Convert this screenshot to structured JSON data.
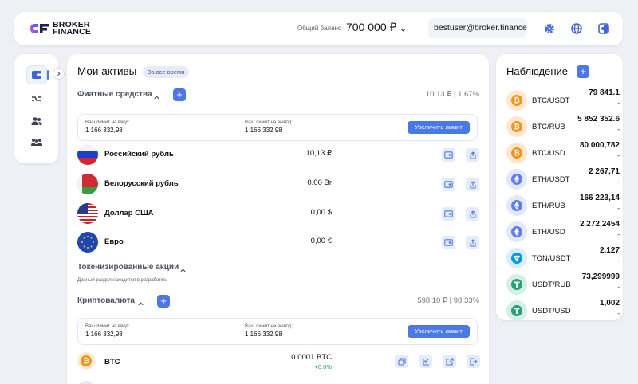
{
  "header": {
    "logo_line1": "BROKER",
    "logo_line2": "FINANCE",
    "balance_label": "Общий баланс",
    "balance_value": "700 000 ₽",
    "email": "bestuser@broker.finance",
    "icons": [
      "gear-icon",
      "globe-icon",
      "half-moon-icon"
    ]
  },
  "sidebar": {
    "items": [
      "wallet-icon",
      "exchange-icon",
      "users-icon",
      "handshake-icon"
    ]
  },
  "main": {
    "title": "Мои активы",
    "period_pill": "За все время",
    "fiat": {
      "title": "Фиатные средства",
      "summary": "10.13 ₽ | 1.67%",
      "limits": {
        "deposit_label": "Ваш лимит на ввод:",
        "deposit_value": "1 166 332,98",
        "withdraw_label": "Ваш лимит на вывод:",
        "withdraw_value": "1 166 332,98",
        "button": "Увеличить лимит"
      },
      "rows": [
        {
          "name": "Российский рубль",
          "amount": "10,13 ₽"
        },
        {
          "name": "Белорусский рубль",
          "amount": "0.00 Br"
        },
        {
          "name": "Доллар США",
          "amount": "0,00 $"
        },
        {
          "name": "Евро",
          "amount": "0,00 €"
        }
      ]
    },
    "stocks": {
      "title": "Токенизированные акции",
      "note": "Данный раздел находится в разработке."
    },
    "crypto": {
      "title": "Криптовалюта",
      "summary": "598.10 ₽ | 98.33%",
      "limits": {
        "deposit_label": "Ваш лимит на ввод:",
        "deposit_value": "1 166 332,98",
        "withdraw_label": "Ваш лимит на вывод:",
        "withdraw_value": "1 166 332,98",
        "button": "Увеличить лимит"
      },
      "rows": [
        {
          "name": "BTC",
          "amount": "0.0001 BTC",
          "change": "+0.0%"
        }
      ]
    }
  },
  "watchlist": {
    "title": "Наблюдение",
    "items": [
      {
        "pair": "BTC/USDT",
        "price": "79 841.1",
        "change": "-",
        "coin": "btc"
      },
      {
        "pair": "BTC/RUB",
        "price": "5 852 352.6",
        "change": "-",
        "coin": "btc"
      },
      {
        "pair": "BTC/USD",
        "price": "80 000,782",
        "change": "-",
        "coin": "btc"
      },
      {
        "pair": "ETH/USDT",
        "price": "2 267,71",
        "change": "-",
        "coin": "eth"
      },
      {
        "pair": "ETH/RUB",
        "price": "166 223,14",
        "change": "-",
        "coin": "eth"
      },
      {
        "pair": "ETH/USD",
        "price": "2 272,2454",
        "change": "-",
        "coin": "eth"
      },
      {
        "pair": "TON/USDT",
        "price": "2,127",
        "change": "-",
        "coin": "ton"
      },
      {
        "pair": "USDT/RUB",
        "price": "73,299999",
        "change": "-",
        "coin": "usdt"
      },
      {
        "pair": "USDT/USD",
        "price": "1,002",
        "change": "-",
        "coin": "usdt"
      }
    ]
  },
  "colors": {
    "accent": "#4b79e4",
    "btc": "#f7931a",
    "eth": "#627eea",
    "ton": "#0098ea",
    "usdt": "#26a17b",
    "positive": "#27a55b"
  }
}
